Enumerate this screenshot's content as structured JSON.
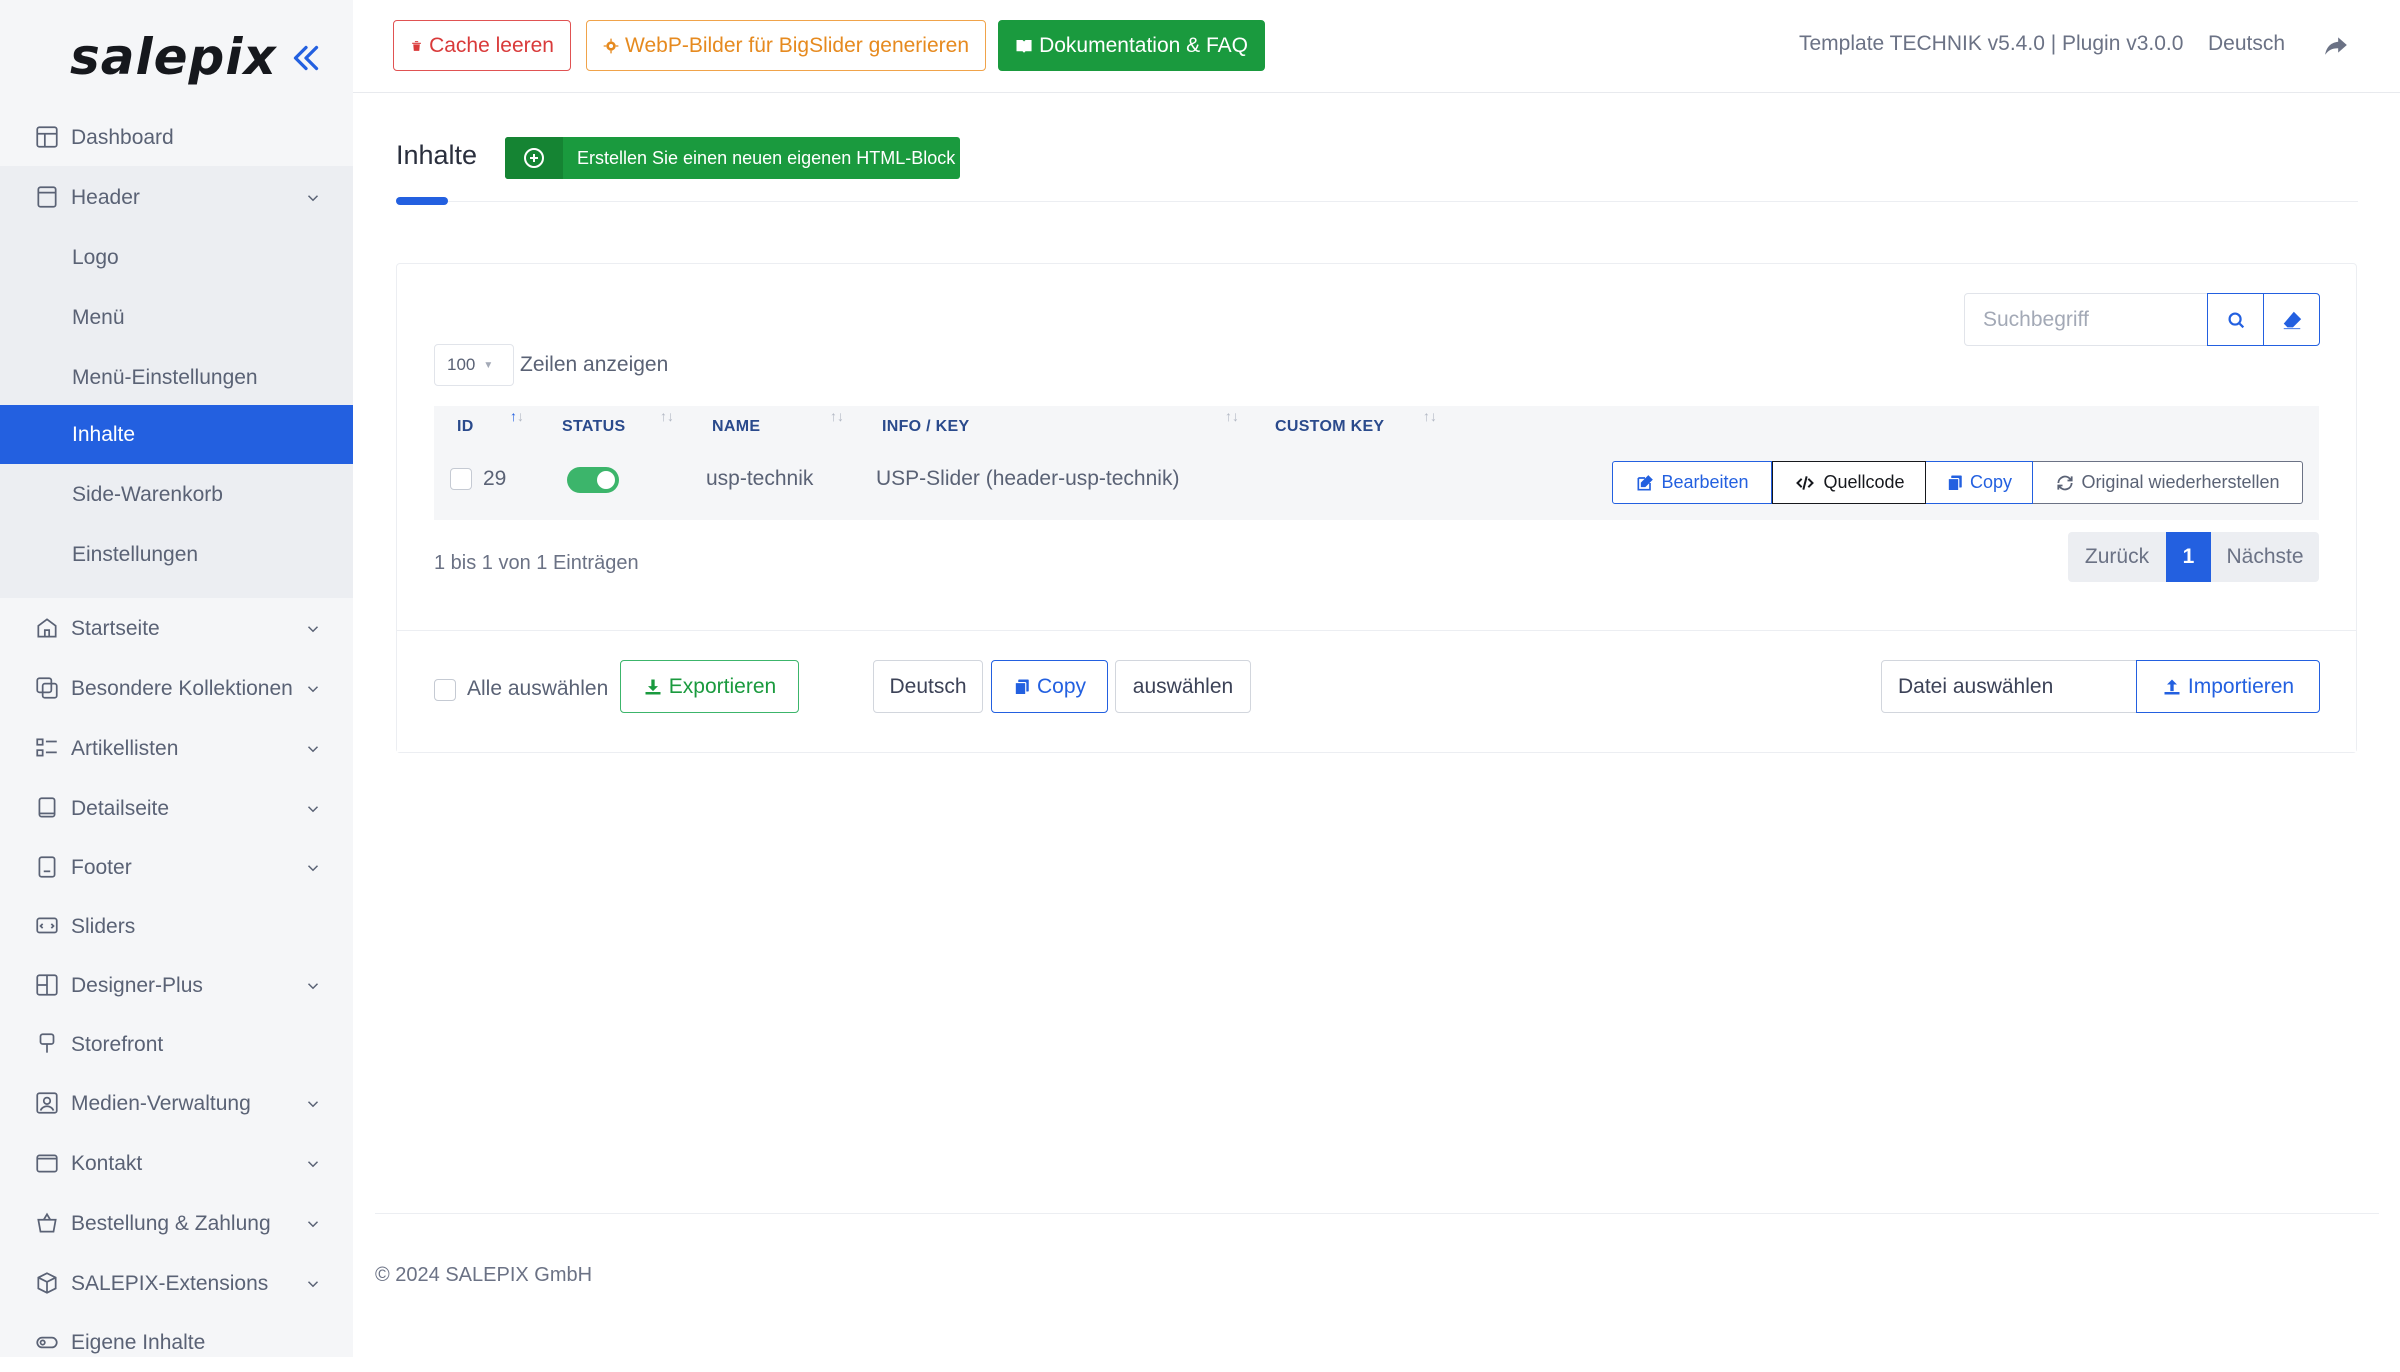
{
  "sidebar": {
    "logo": "salepix",
    "items": [
      {
        "label": "Dashboard"
      },
      {
        "label": "Header"
      },
      {
        "label": "Logo"
      },
      {
        "label": "Menü"
      },
      {
        "label": "Menü-Einstellungen"
      },
      {
        "label": "Inhalte"
      },
      {
        "label": "Side-Warenkorb"
      },
      {
        "label": "Einstellungen"
      },
      {
        "label": "Startseite"
      },
      {
        "label": "Besondere Kollektionen"
      },
      {
        "label": "Artikellisten"
      },
      {
        "label": "Detailseite"
      },
      {
        "label": "Footer"
      },
      {
        "label": "Sliders"
      },
      {
        "label": "Designer-Plus"
      },
      {
        "label": "Storefront"
      },
      {
        "label": "Medien-Verwaltung"
      },
      {
        "label": "Kontakt"
      },
      {
        "label": "Bestellung & Zahlung"
      },
      {
        "label": "SALEPIX-Extensions"
      },
      {
        "label": "Eigene Inhalte"
      }
    ]
  },
  "topbar": {
    "cache_label": "Cache leeren",
    "webp_label": "WebP-Bilder für BigSlider generieren",
    "doc_label": "Dokumentation & FAQ",
    "version": "Template TECHNIK v5.4.0 | Plugin v3.0.0",
    "language": "Deutsch"
  },
  "page": {
    "title": "Inhalte",
    "new_block_label": "Erstellen Sie einen neuen eigenen HTML-Block"
  },
  "table": {
    "search_placeholder": "Suchbegriff",
    "page_length": "100",
    "page_length_label": "Zeilen anzeigen",
    "columns": {
      "id": "ID",
      "status": "STATUS",
      "name": "NAME",
      "info": "INFO / KEY",
      "custom": "CUSTOM KEY"
    },
    "rows": [
      {
        "id": "29",
        "status": true,
        "name": "usp-technik",
        "info": "USP-Slider (header-usp-technik)",
        "custom": ""
      }
    ],
    "actions": {
      "edit": "Bearbeiten",
      "source": "Quellcode",
      "copy": "Copy",
      "restore": "Original wiederherstellen"
    },
    "info_text": "1 bis 1 von 1 Einträgen",
    "pager": {
      "prev": "Zurück",
      "current": "1",
      "next": "Nächste"
    }
  },
  "footer_bar": {
    "select_all": "Alle auswählen",
    "export": "Exportieren",
    "language": "Deutsch",
    "copy": "Copy",
    "choose": "auswählen",
    "file": "Datei auswählen",
    "import": "Importieren"
  },
  "colors": {
    "accent": "#2360e0",
    "success": "#1a9a3e",
    "danger": "#d93a3a",
    "warning": "#e68a1f"
  },
  "copyright": "© 2024 SALEPIX GmbH"
}
